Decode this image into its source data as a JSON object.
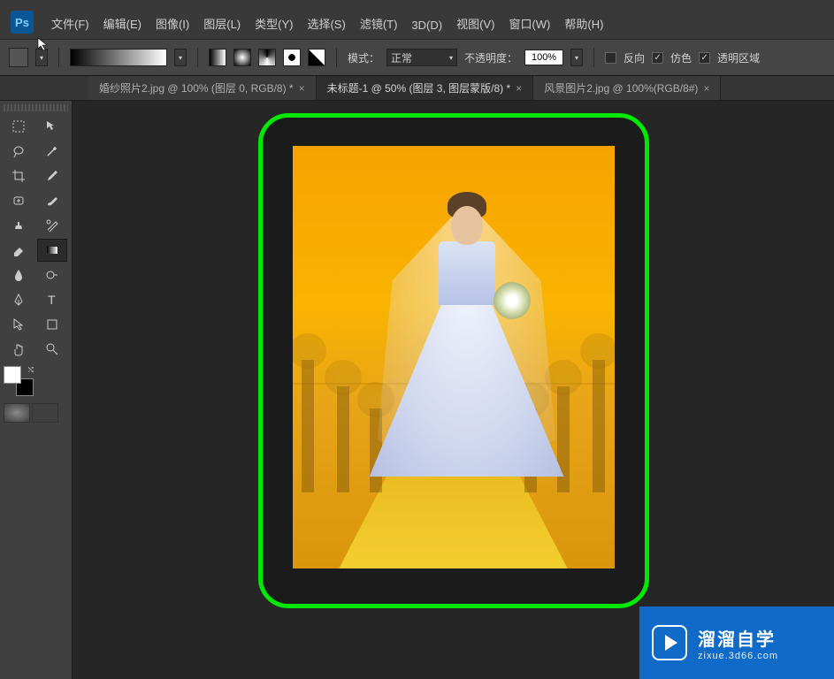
{
  "app": {
    "logo": "Ps"
  },
  "menu": {
    "file": "文件(F)",
    "edit": "编辑(E)",
    "image": "图像(I)",
    "layer": "图层(L)",
    "type": "类型(Y)",
    "select": "选择(S)",
    "filter": "滤镜(T)",
    "threeD": "3D(D)",
    "view": "视图(V)",
    "window": "窗口(W)",
    "help": "帮助(H)"
  },
  "options": {
    "mode_label": "模式：",
    "mode_value": "正常",
    "opacity_label": "不透明度：",
    "opacity_value": "100%",
    "reverse_label": "反向",
    "reverse_checked": false,
    "dither_label": "仿色",
    "dither_checked": true,
    "transparency_label": "透明区域",
    "transparency_checked": true
  },
  "tabs": [
    {
      "label": "婚纱照片2.jpg @ 100% (图层 0, RGB/8) *",
      "active": false
    },
    {
      "label": "未标题-1 @ 50% (图层 3, 图层蒙版/8) *",
      "active": true
    },
    {
      "label": "风景图片2.jpg @ 100%(RGB/8#)",
      "active": false
    }
  ],
  "tools": {
    "marquee": "marquee",
    "move": "move",
    "lasso": "lasso",
    "wand": "wand",
    "crop": "crop",
    "eyedrop": "eyedrop",
    "heal": "heal",
    "brush": "brush",
    "stamp": "stamp",
    "history": "history",
    "eraser": "eraser",
    "gradient": "gradient",
    "blur": "blur",
    "dodge": "dodge",
    "pen": "pen",
    "text": "text",
    "path": "path",
    "shape": "shape",
    "hand": "hand",
    "zoom": "zoom"
  },
  "watermark": {
    "title": "溜溜自学",
    "sub": "zixue.3d66.com"
  }
}
